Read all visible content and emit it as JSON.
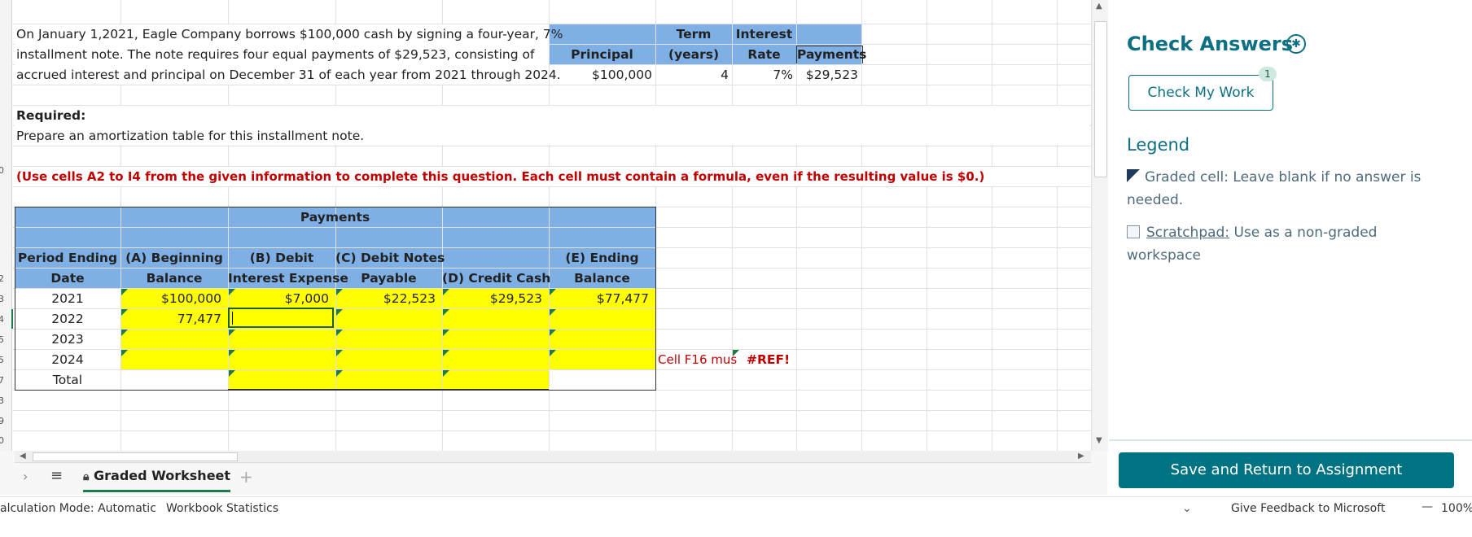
{
  "problem": {
    "line1": "On January 1,2021, Eagle Company borrows $100,000 cash by signing a four-year, 7%",
    "line2": "installment note. The note requires four equal payments of  $29,523, consisting of",
    "line3": "accrued interest and principal on December 31 of each year from 2021 through 2024.",
    "required_label": "Required:",
    "required_text": "Prepare an amortization table for this installment note.",
    "instruction": "(Use cells A2 to I4 from the given information to complete this question.  Each cell must contain a formula, even if the resulting value is $0.)"
  },
  "given": {
    "principal_header": "Principal",
    "principal_value": "$100,000",
    "term_header1": "Term",
    "term_header2": "(years)",
    "term_value": "4",
    "rate_header1": "Interest",
    "rate_header2": "Rate",
    "rate_value": "7%",
    "payments_header": "Payments",
    "payments_value": "$29,523"
  },
  "table": {
    "payments_title": "Payments",
    "headers": {
      "a1": "Period Ending",
      "a2": "Date",
      "b1": "(A) Beginning",
      "b2": "Balance",
      "c1": "(B) Debit",
      "c2": "Interest Expense",
      "d1": "(C) Debit Notes",
      "d2": "Payable",
      "e1": "(D) Credit Cash",
      "f1": "(E) Ending",
      "f2": "Balance"
    },
    "rows": [
      {
        "date": "2021",
        "begin": "$100,000",
        "interest": "$7,000",
        "notes": "$22,523",
        "cash": "$29,523",
        "ending": "$77,477"
      },
      {
        "date": "2022",
        "begin": "77,477",
        "interest": "",
        "notes": "",
        "cash": "",
        "ending": ""
      },
      {
        "date": "2023",
        "begin": "",
        "interest": "",
        "notes": "",
        "cash": "",
        "ending": ""
      },
      {
        "date": "2024",
        "begin": "",
        "interest": "",
        "notes": "",
        "cash": "",
        "ending": ""
      }
    ],
    "total_label": "Total",
    "note_text": "Cell F16 mus",
    "ref_error": "#REF!"
  },
  "sheet_tab": {
    "name": "Graded Worksheet",
    "add": "+"
  },
  "status": {
    "calc_mode": "alculation Mode: Automatic",
    "stats": "Workbook Statistics",
    "feedback": "Give Feedback to Microsoft",
    "zoom": "100%"
  },
  "panel": {
    "title": "Check Answers",
    "check_button": "Check My Work",
    "badge_count": "1",
    "legend_title": "Legend",
    "graded_text": "Graded cell: Leave blank if no answer is needed.",
    "scratch_label": "Scratchpad:",
    "scratch_text": " Use as a non-graded workspace",
    "save_button": "Save and Return to Assignment"
  },
  "row_numbers": [
    "0",
    "2",
    "3",
    "4",
    "5",
    "5",
    "7",
    "3",
    "9",
    "0"
  ],
  "colors": {
    "accent": "#007383",
    "blue_fill": "#7eb0e6",
    "yellow_fill": "#ffff00",
    "red_text": "#c00000"
  }
}
